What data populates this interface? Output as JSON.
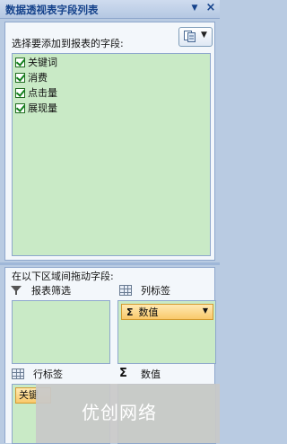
{
  "panel": {
    "title": "数据透视表字段列表",
    "dropdown_icon": "chevron-down-icon",
    "close_icon": "close-icon"
  },
  "field_section": {
    "label": "选择要添加到报表的字段:",
    "layout_button_icon": "field-list-layout-icon",
    "fields": [
      {
        "label": "关键词",
        "checked": true
      },
      {
        "label": "消费",
        "checked": true
      },
      {
        "label": "点击量",
        "checked": true
      },
      {
        "label": "展现量",
        "checked": true
      }
    ]
  },
  "areas": {
    "drag_label": "在以下区域间拖动字段:",
    "report_filter": {
      "label": "报表筛选",
      "icon": "filter-icon"
    },
    "column_labels": {
      "label": "列标签",
      "icon": "grid-icon",
      "items": [
        {
          "label": "数值",
          "icon": "sigma-icon"
        }
      ]
    },
    "row_labels": {
      "label": "行标签",
      "icon": "grid-icon",
      "items": [
        {
          "label": "关键"
        }
      ]
    },
    "values": {
      "label": "数值",
      "icon": "sigma-icon"
    }
  },
  "watermark": "优创网络",
  "colors": {
    "accent": "#15428b",
    "area_bg": "#c9eac6",
    "chip_bg": "#f9c96b"
  }
}
